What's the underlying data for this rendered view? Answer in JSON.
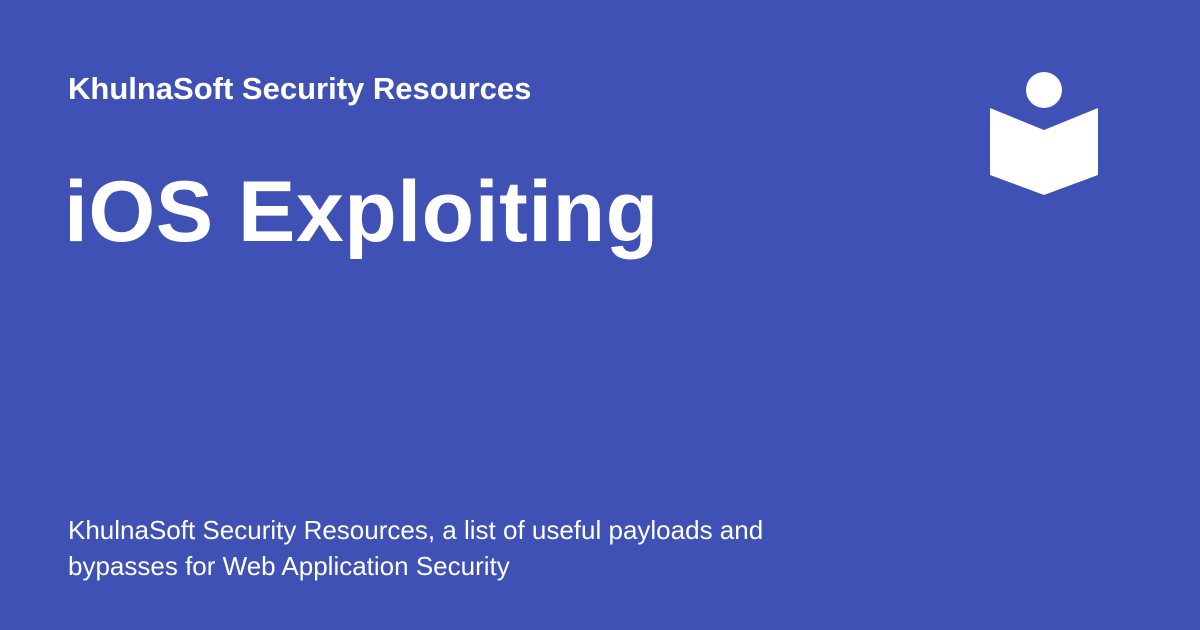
{
  "header": {
    "site_name": "KhulnaSoft Security Resources"
  },
  "main": {
    "title": "iOS Exploiting"
  },
  "footer": {
    "description": "KhulnaSoft Security Resources, a list of useful payloads and bypasses for Web Application Security"
  },
  "logo": {
    "icon": "reader-book-icon"
  },
  "colors": {
    "background": "#3f51b5",
    "text": "#ffffff"
  }
}
